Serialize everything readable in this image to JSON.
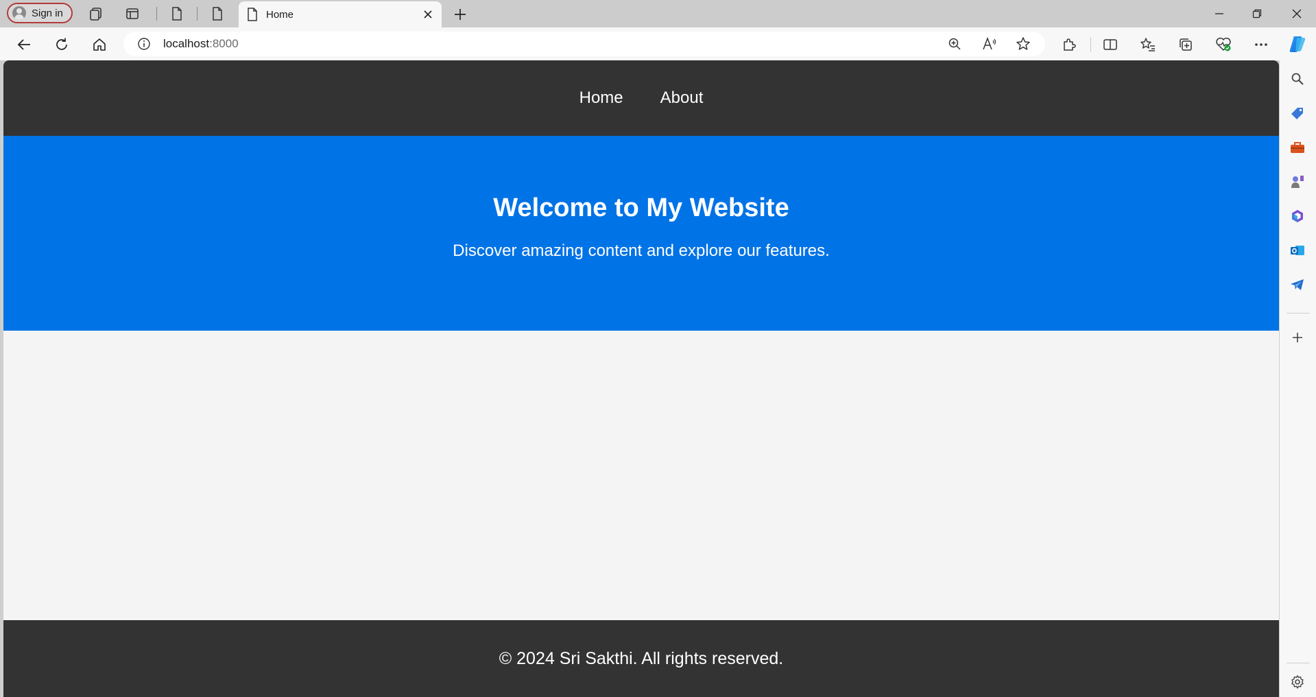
{
  "browser": {
    "signin_label": "Sign in",
    "tab": {
      "title": "Home"
    },
    "address": {
      "host": "localhost",
      "port": ":8000"
    }
  },
  "site": {
    "nav": [
      {
        "label": "Home"
      },
      {
        "label": "About"
      }
    ],
    "hero": {
      "title": "Welcome to My Website",
      "subtitle": "Discover amazing content and explore our features."
    },
    "footer": "© 2024 Sri Sakthi. All rights reserved.",
    "colors": {
      "nav_bg": "#333333",
      "hero_bg": "#0073e6",
      "body_bg": "#f4f4f4"
    }
  },
  "icons": {
    "tabstrip": [
      "workspaces-icon",
      "vertical-tabs-icon",
      "page-icon",
      "page-icon"
    ],
    "toolbar_left": [
      "back-icon",
      "refresh-icon",
      "home-icon"
    ],
    "address_right": [
      "zoom-icon",
      "read-aloud-icon",
      "favorite-star-icon"
    ],
    "toolbar_right": [
      "extensions-icon",
      "split-screen-icon",
      "favorites-icon",
      "collections-icon",
      "browser-essentials-icon",
      "more-icon"
    ],
    "sidebar": [
      "search-icon",
      "shopping-icon",
      "tools-icon",
      "games-icon",
      "microsoft365-icon",
      "outlook-icon",
      "telegram-icon",
      "add-icon",
      "settings-icon"
    ]
  }
}
